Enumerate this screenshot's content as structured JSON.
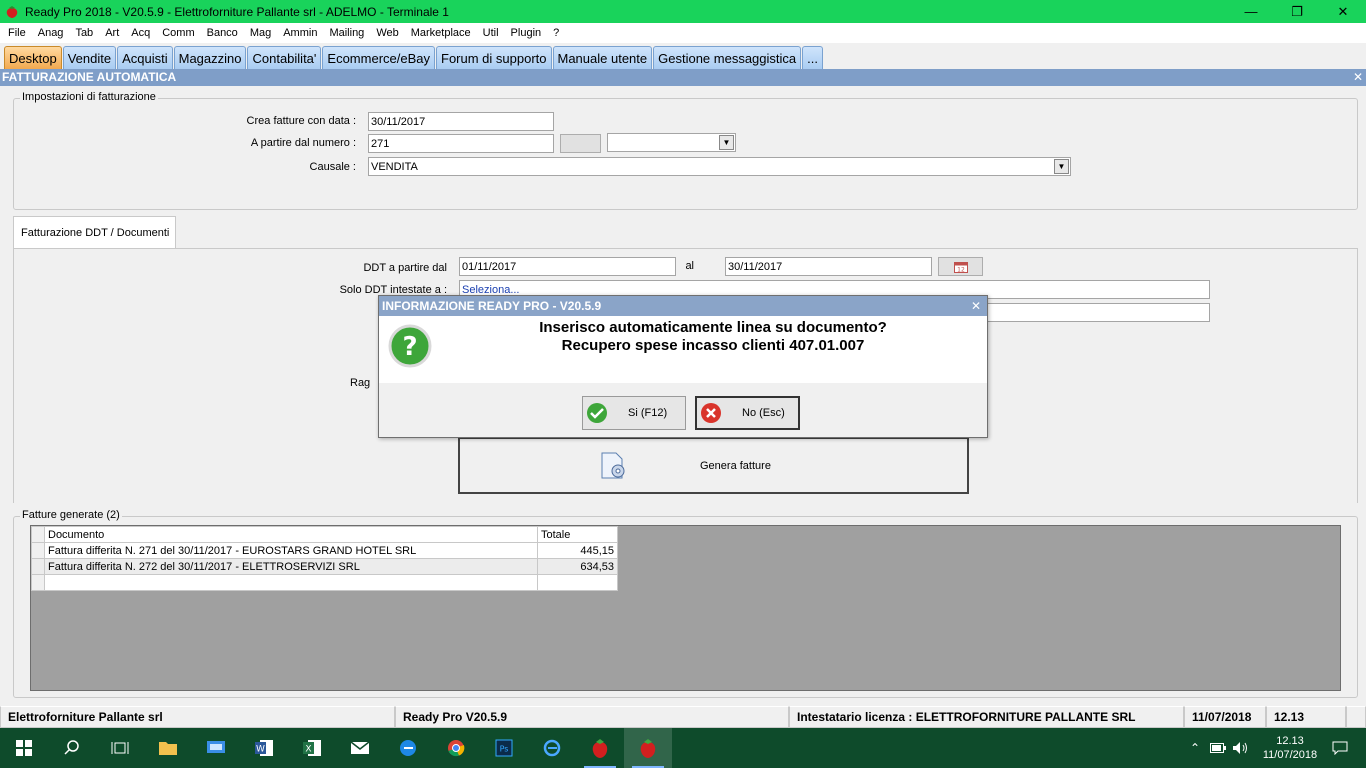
{
  "window": {
    "title": "Ready Pro 2018 - V20.5.9 - Elettroforniture Pallante srl - ADELMO - Terminale 1",
    "minimize": "—",
    "restore": "❐",
    "close": "✕"
  },
  "menu": [
    "File",
    "Anag",
    "Tab",
    "Art",
    "Acq",
    "Comm",
    "Banco",
    "Mag",
    "Ammin",
    "Mailing",
    "Web",
    "Marketplace",
    "Util",
    "Plugin",
    "?"
  ],
  "tabs": [
    {
      "label": "Desktop",
      "active": true
    },
    {
      "label": "Vendite"
    },
    {
      "label": "Acquisti"
    },
    {
      "label": "Magazzino"
    },
    {
      "label": "Contabilita'"
    },
    {
      "label": "Ecommerce/eBay"
    },
    {
      "label": "Forum di supporto"
    },
    {
      "label": "Manuale utente"
    },
    {
      "label": "Gestione messaggistica"
    },
    {
      "label": "..."
    }
  ],
  "section": {
    "title": "FATTURAZIONE AUTOMATICA",
    "close": "✕"
  },
  "settings": {
    "legend": "Impostazioni di fatturazione",
    "date_label": "Crea fatture con data :",
    "date_value": "30/11/2017",
    "number_label": "A partire dal numero :",
    "number_value": "271",
    "causale_label": "Causale :",
    "causale_value": "VENDITA"
  },
  "ddt": {
    "tab_label": "Fatturazione DDT / Documenti",
    "from_label": "DDT a partire dal",
    "from_value": "01/11/2017",
    "to_label": "al",
    "to_value": "30/11/2017",
    "solo_label": "Solo DDT intestate a :",
    "solo_value": "Seleziona...",
    "rag_label": "Rag",
    "genera_label": "Genera fatture"
  },
  "generated": {
    "legend": "Fatture generate (2)",
    "headers": [
      "Documento",
      "Totale"
    ],
    "rows": [
      {
        "doc": "Fattura differita N. 271 del 30/11/2017 - EUROSTARS GRAND HOTEL SRL",
        "total": "445,15"
      },
      {
        "doc": "Fattura differita N. 272 del 30/11/2017 - ELETTROSERVIZI SRL",
        "total": "634,53"
      }
    ]
  },
  "status": {
    "company": "Elettroforniture Pallante srl",
    "version": "Ready Pro V20.5.9",
    "license": "Intestatario licenza : ELETTROFORNITURE PALLANTE SRL",
    "date": "11/07/2018",
    "time": "12.13"
  },
  "dialog": {
    "title": "INFORMAZIONE READY PRO - V20.5.9",
    "close": "✕",
    "line1": "Inserisco automaticamente linea su documento?",
    "line2": "Recupero spese incasso clienti 407.01.007",
    "yes_label": "Si (F12)",
    "no_label": "No (Esc)"
  },
  "taskbar": {
    "time": "12.13",
    "date": "11/07/2018"
  },
  "colors": {
    "titlebar": "#19d35b",
    "section_header": "#7f9ec8",
    "taskbar": "#0e4b2b"
  }
}
